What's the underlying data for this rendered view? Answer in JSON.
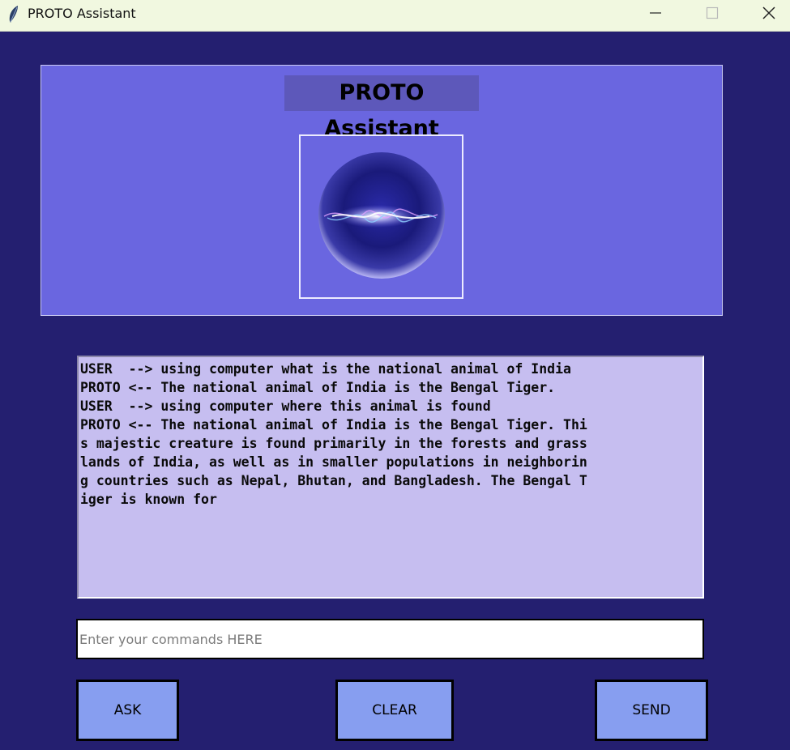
{
  "window": {
    "title": "PROTO Assistant",
    "icon": "feather-icon",
    "controls": [
      "minimize-icon",
      "maximize-icon",
      "close-icon"
    ]
  },
  "header": {
    "title": "PROTO Assistant",
    "image": "voice-orb-icon"
  },
  "chat": {
    "lines": [
      "USER  --> using computer what is the national animal of India",
      "PROTO <-- The national animal of India is the Bengal Tiger.",
      "USER  --> using computer where this animal is found",
      "PROTO <-- The national animal of India is the Bengal Tiger. Thi",
      "s majestic creature is found primarily in the forests and grass",
      "lands of India, as well as in smaller populations in neighborin",
      "g countries such as Nepal, Bhutan, and Bangladesh. The Bengal T",
      "iger is known for"
    ]
  },
  "command": {
    "placeholder": "Enter your commands HERE",
    "value": ""
  },
  "buttons": {
    "ask": "ASK",
    "clear": "CLEAR",
    "send": "SEND"
  },
  "colors": {
    "background": "#241f70",
    "header_panel": "#6a66e0",
    "title_label": "#5d58ba",
    "chat_bg": "#c6bef0",
    "button": "#879ef0",
    "titlebar": "#f1f8e0"
  }
}
